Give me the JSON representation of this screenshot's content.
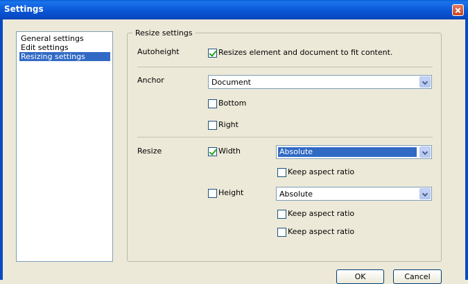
{
  "window": {
    "title": "Settings"
  },
  "nav": {
    "items": [
      "General settings",
      "Edit settings",
      "Resizing settings"
    ],
    "selected_index": 2
  },
  "group": {
    "legend": "Resize settings"
  },
  "autoheight": {
    "label": "Autoheight",
    "checkbox_label": "Resizes element and document to fit content.",
    "checked": true
  },
  "anchor": {
    "label": "Anchor",
    "select_value": "Document",
    "bottom_label": "Bottom",
    "bottom_checked": false,
    "right_label": "Right",
    "right_checked": false
  },
  "resize": {
    "label": "Resize",
    "width_label": "Width",
    "width_checked": true,
    "width_select_value": "Absolute",
    "width_keep_aspect_label": "Keep aspect ratio",
    "width_keep_aspect_checked": false,
    "height_label": "Height",
    "height_checked": false,
    "height_select_value": "Absolute",
    "height_keep_aspect_label": "Keep aspect ratio",
    "height_keep_aspect_checked": false,
    "extra_keep_aspect_label": "Keep aspect ratio",
    "extra_keep_aspect_checked": false
  },
  "buttons": {
    "ok": "OK",
    "cancel": "Cancel"
  },
  "colors": {
    "titlebar": "#0a56d6",
    "selection": "#316ac5",
    "checkmark": "#21a121"
  }
}
